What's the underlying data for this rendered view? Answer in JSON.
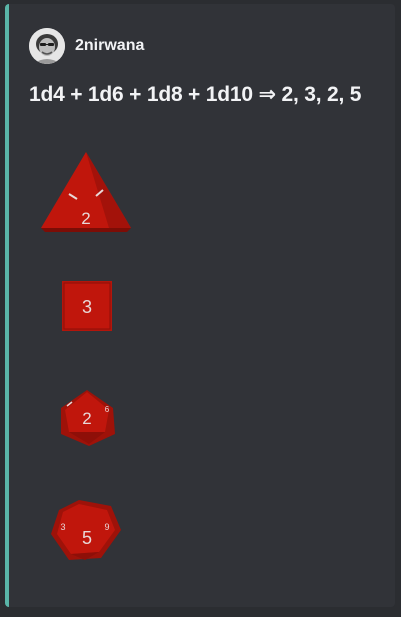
{
  "author": {
    "name": "2nirwana",
    "avatar_icon": "user-avatar"
  },
  "roll": {
    "title": "1d4 + 1d6 + 1d8 + 1d10 ⇒ 2, 3, 2, 5"
  },
  "dice": [
    {
      "type": "d4",
      "value": "2",
      "icon": "d4-die-icon"
    },
    {
      "type": "d6",
      "value": "3",
      "icon": "d6-die-icon"
    },
    {
      "type": "d8",
      "value": "2",
      "icon": "d8-die-icon"
    },
    {
      "type": "d10",
      "value": "5",
      "icon": "d10-die-icon"
    }
  ],
  "colors": {
    "accent": "#5ab5a8",
    "card": "#313338",
    "background": "#2b2d31",
    "die_red": "#c0160c",
    "die_dark": "#8e0f08",
    "die_text": "#e8d8d8"
  }
}
